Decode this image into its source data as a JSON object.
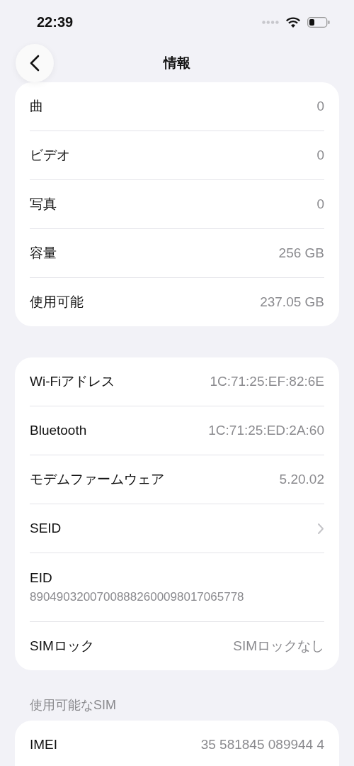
{
  "status_bar": {
    "time": "22:39"
  },
  "nav": {
    "title": "情報"
  },
  "sections": [
    {
      "rows": [
        {
          "kind": "value",
          "label": "曲",
          "value": "0"
        },
        {
          "kind": "value",
          "label": "ビデオ",
          "value": "0"
        },
        {
          "kind": "value",
          "label": "写真",
          "value": "0"
        },
        {
          "kind": "value",
          "label": "容量",
          "value": "256 GB"
        },
        {
          "kind": "value",
          "label": "使用可能",
          "value": "237.05 GB"
        }
      ]
    },
    {
      "rows": [
        {
          "kind": "value",
          "label": "Wi-Fiアドレス",
          "value": "1C:71:25:EF:82:6E"
        },
        {
          "kind": "value",
          "label": "Bluetooth",
          "value": "1C:71:25:ED:2A:60"
        },
        {
          "kind": "value",
          "label": "モデムファームウェア",
          "value": "5.20.02"
        },
        {
          "kind": "chevron",
          "label": "SEID"
        },
        {
          "kind": "stacked",
          "label": "EID",
          "value": "89049032007008882600098017065778"
        },
        {
          "kind": "value",
          "label": "SIMロック",
          "value": "SIMロックなし"
        }
      ]
    },
    {
      "header": "使用可能なSIM",
      "continued": true,
      "rows": [
        {
          "kind": "value",
          "label": "IMEI",
          "value": "35 581845 089944 4"
        }
      ]
    }
  ]
}
